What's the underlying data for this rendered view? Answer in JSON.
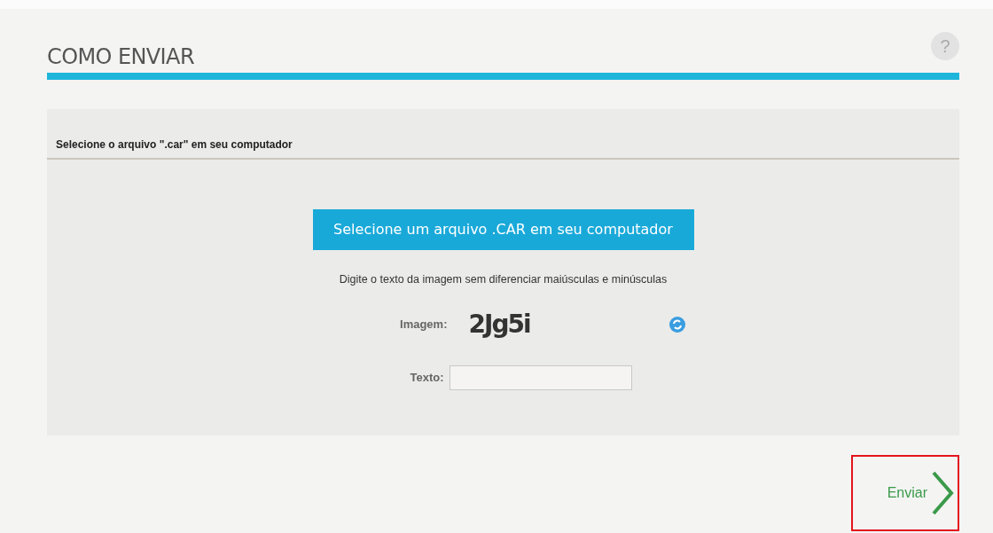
{
  "page": {
    "title": "COMO ENVIAR",
    "help": "?"
  },
  "section": {
    "heading": "Selecione o arquivo \".car\" em seu computador"
  },
  "upload_button": {
    "label": "Selecione um arquivo .CAR em seu computador"
  },
  "captcha": {
    "instructions": "Digite o texto da imagem sem diferenciar maiúsculas e minúsculas",
    "image_label": "Imagem:",
    "image_text": "2Jg5i",
    "text_label": "Texto:"
  },
  "submit": {
    "label": "Enviar",
    "highlighted": true
  }
}
